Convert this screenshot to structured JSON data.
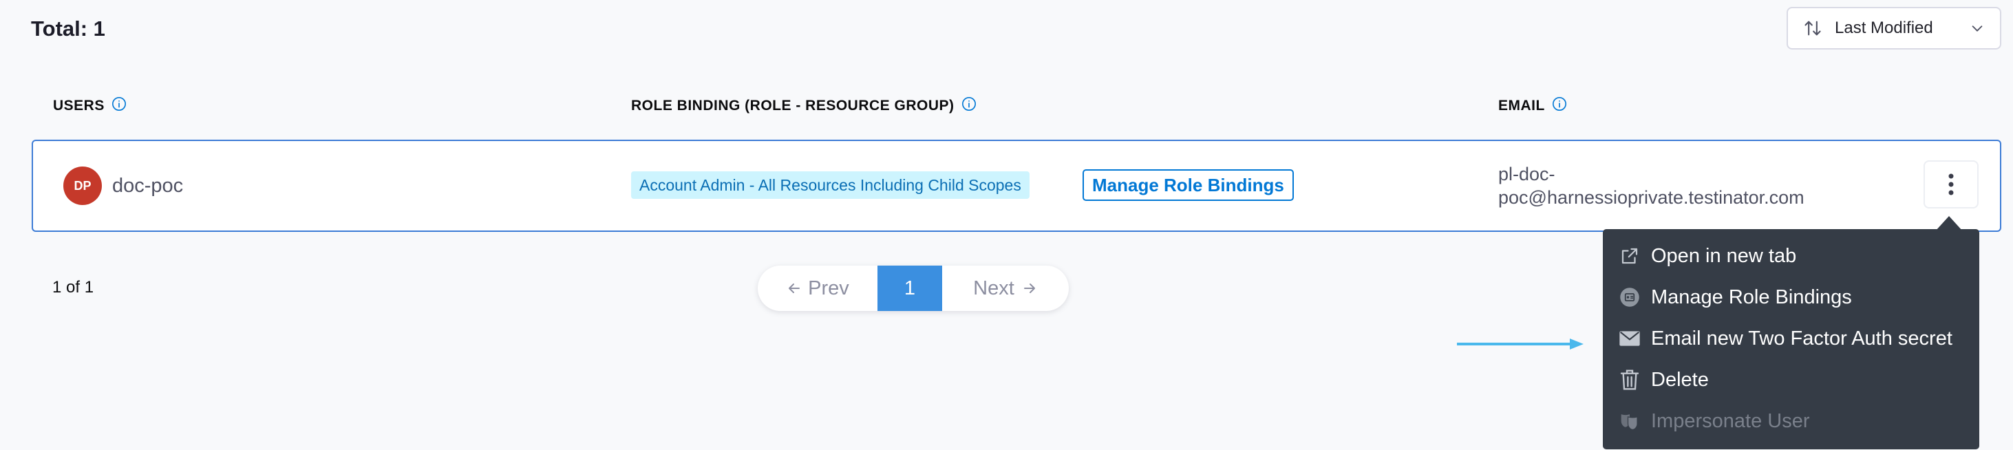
{
  "summary": {
    "total_label": "Total: 1"
  },
  "sort": {
    "label": "Last Modified",
    "icon": "sort-icon",
    "chevron": "chevron-down-icon"
  },
  "columns": [
    {
      "label": "USERS",
      "icon": "info-icon"
    },
    {
      "label": "ROLE BINDING (ROLE - RESOURCE GROUP)",
      "icon": "info-icon"
    },
    {
      "label": "EMAIL",
      "icon": "info-icon"
    }
  ],
  "row": {
    "avatar_initials": "DP",
    "avatar_color": "#c5392a",
    "username": "doc-poc",
    "role_binding": "Account Admin - All Resources Including Child Scopes",
    "manage_label": "Manage Role Bindings",
    "email_line1": "pl-doc-",
    "email_line2": "poc@harnessioprivate.testinator.com"
  },
  "pagination": {
    "count_label": "1 of 1",
    "prev_label": "Prev",
    "current_page": "1",
    "next_label": "Next"
  },
  "menu": {
    "items": [
      {
        "label": "Open in new tab",
        "icon": "external-link-icon",
        "enabled": true
      },
      {
        "label": "Manage Role Bindings",
        "icon": "role-binding-icon",
        "enabled": true
      },
      {
        "label": "Email new Two Factor Auth secret",
        "icon": "envelope-icon",
        "enabled": true
      },
      {
        "label": "Delete",
        "icon": "trash-icon",
        "enabled": true
      },
      {
        "label": "Impersonate User",
        "icon": "impersonate-icon",
        "enabled": false
      }
    ]
  },
  "colors": {
    "accent": "#0278d5",
    "row_border": "#3d7cd6",
    "menu_bg": "#353c46",
    "annotation_arrow": "#4ab8ec"
  }
}
